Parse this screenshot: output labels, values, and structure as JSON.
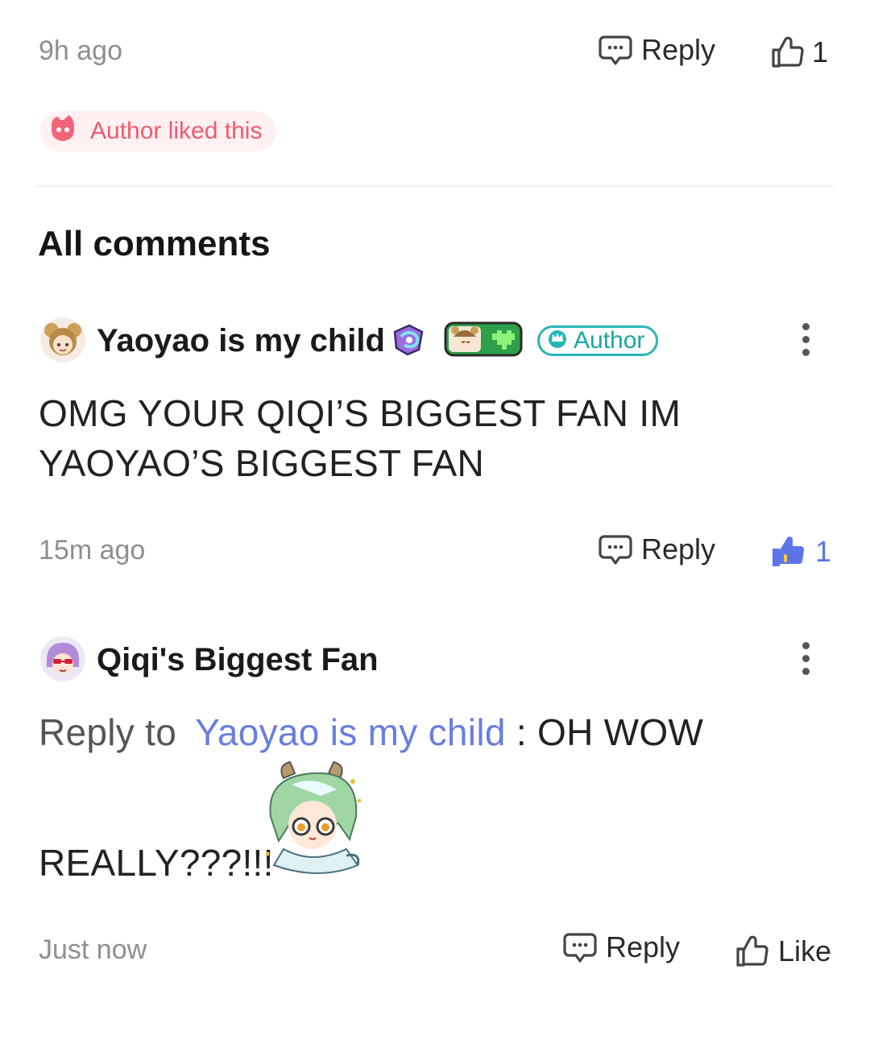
{
  "top_comment": {
    "time": "9h ago",
    "reply_label": "Reply",
    "like_count": "1",
    "author_liked": "Author liked this"
  },
  "section_title": "All comments",
  "comments": [
    {
      "username": "Yaoyao is my child",
      "author_badge": "Author",
      "text_line1": "OMG YOUR QIQI’S BIGGEST FAN IM",
      "text_line2": "YAOYAO’S BIGGEST FAN",
      "time": "15m ago",
      "reply_label": "Reply",
      "like_count": "1",
      "liked": true
    },
    {
      "username": "Qiqi's Biggest Fan",
      "reply_prefix": "Reply to",
      "reply_target": "Yaoyao is my child",
      "reply_sep": " : ",
      "text_line1": "OH WOW",
      "text_line2": "REALLY???!!!",
      "time": "Just now",
      "reply_label": "Reply",
      "like_label": "Like",
      "liked": false
    }
  ],
  "colors": {
    "accent_blue": "#5b74e8",
    "author_teal": "#26b7b4",
    "liked_pink": "#f05b6f",
    "meta_gray": "#8e8e93"
  },
  "icons": [
    "reply-icon",
    "thumbs-up-icon",
    "thumbs-up-filled-icon",
    "author-heart-icon",
    "more-vertical-icon",
    "crown-icon"
  ]
}
